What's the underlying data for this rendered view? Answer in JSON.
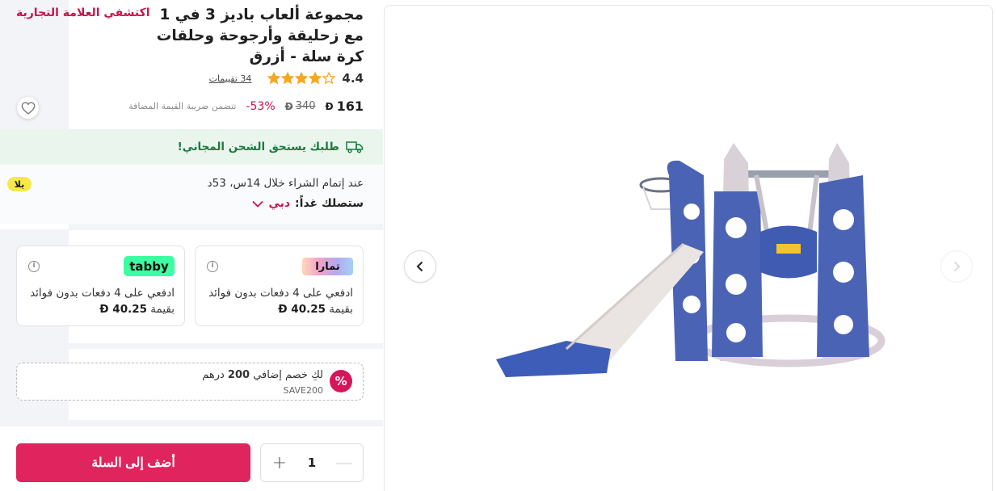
{
  "product": {
    "title": "مجموعة ألعاب باديز 3 في 1 مع زحليقة وأرجوحة وحلقات كرة سلة - أزرق",
    "brand_link": "اكتشفي العلامة التجارية",
    "rating": "4.4",
    "stars_filled": 4.4,
    "ratings_count": "34 تقييمات",
    "price": "161",
    "old_price": "340",
    "discount": "-53%",
    "vat_note": "تتضمن ضريبة القيمة المضافة",
    "currency_symbol": "Ð"
  },
  "shipping": {
    "free_shipping": "طلبك يستحق الشحن المجاني!",
    "order_within": "عند إتمام الشراء خلال 14س، 53د",
    "delivery_label": "ستصلك غداً:",
    "delivery_city": "دبي",
    "badge": "يلا"
  },
  "installments": [
    {
      "provider": "تمارا",
      "text": "ادفعي على 4 دفعات بدون فوائد بقيمة",
      "amount": "40.25"
    },
    {
      "provider": "tabby",
      "text": "ادفعي على 4 دفعات بدون فوائد بقيمة",
      "amount": "40.25"
    }
  ],
  "coupon": {
    "text_prefix": "لكِ خصم إضافي",
    "amount": "200",
    "text_suffix": "درهم",
    "code": "SAVE200",
    "icon": "%"
  },
  "cart": {
    "add_to_cart": "أضف إلى السلة",
    "quantity": "1",
    "plus": "+",
    "minus": "—"
  },
  "gallery": {
    "icons": [
      "chevron-left-icon",
      "chevron-right-icon"
    ]
  },
  "colors": {
    "accent": "#e0245e",
    "brand_text": "#c5164b",
    "free_shipping_bg": "#eaf5ee",
    "free_shipping_text": "#1a7b3e",
    "star": "#f5a623"
  }
}
